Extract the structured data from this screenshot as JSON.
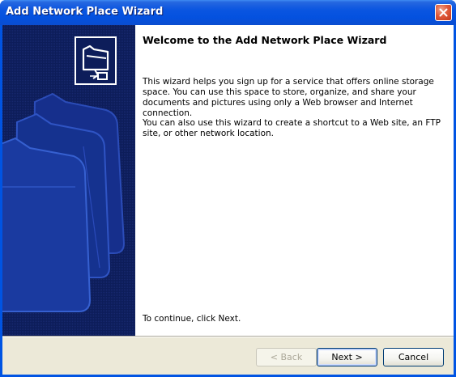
{
  "window": {
    "title": "Add Network Place Wizard"
  },
  "content": {
    "heading": "Welcome to the Add Network Place Wizard",
    "paragraph_1": "This wizard helps you sign up for a service that offers online storage space. You can use this space to store, organize, and share your documents and pictures using only a Web browser and Internet connection.",
    "paragraph_2": "You can also use this wizard to create a shortcut to a Web site, an FTP site, or other network location.",
    "continue_text": "To continue, click Next."
  },
  "buttons": {
    "back_label": "< Back",
    "next_label": "Next >",
    "cancel_label": "Cancel"
  },
  "colors": {
    "titlebar": "#0a55e0",
    "sidepanel": "#0d1d5a",
    "dialog_face": "#ece9d8",
    "close_button": "#e05a3a"
  },
  "icons": {
    "wizard_icon": "network-folder-icon",
    "close_icon": "close-icon",
    "watermark": "folder-watermark"
  }
}
